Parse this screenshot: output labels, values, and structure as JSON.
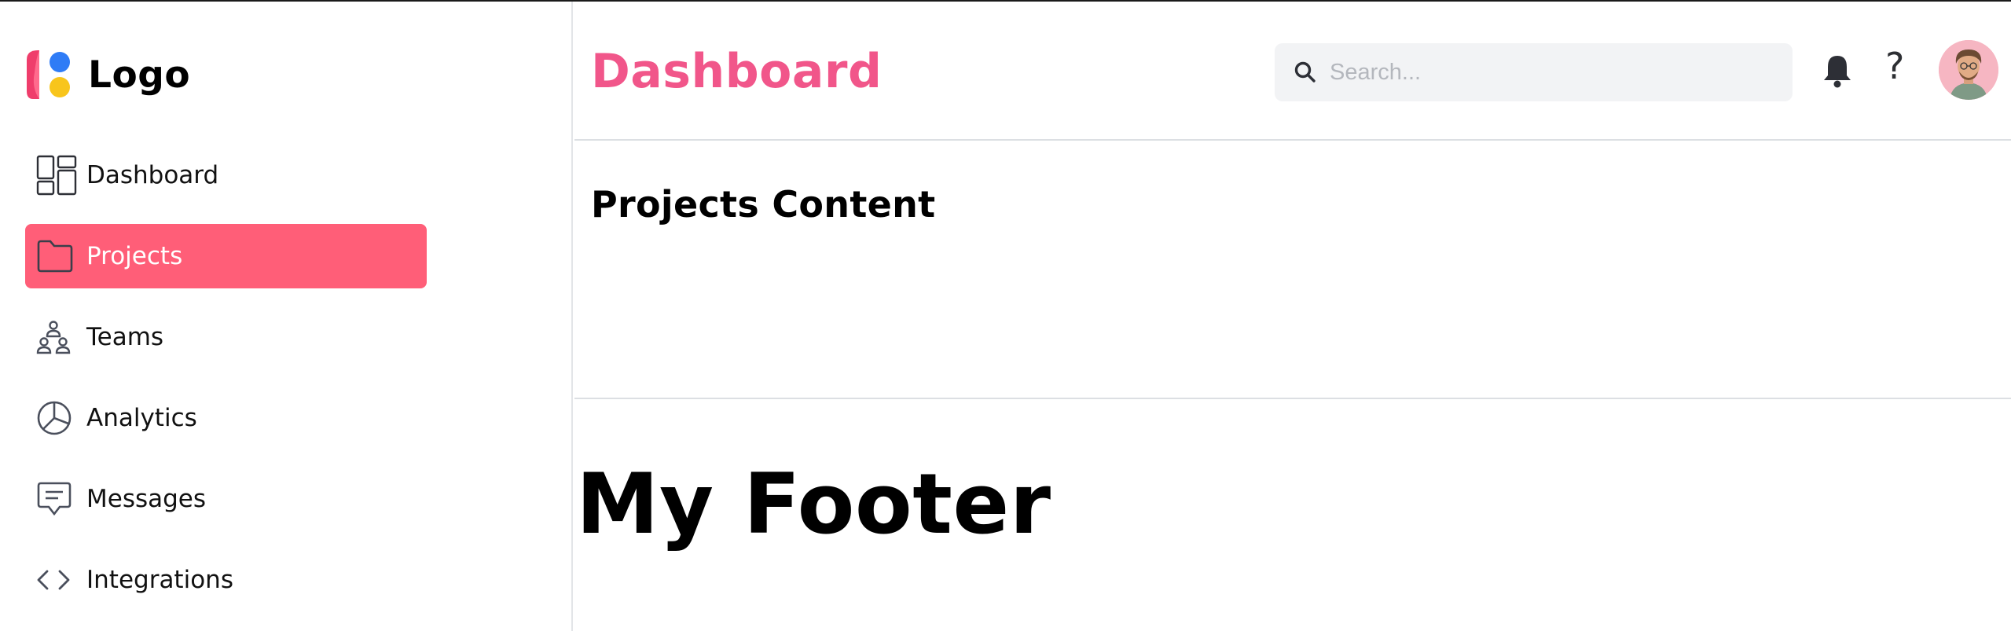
{
  "brand": {
    "logo_text": "Logo"
  },
  "sidebar": {
    "items": [
      {
        "label": "Dashboard",
        "icon": "dashboard-grid-icon",
        "active": false
      },
      {
        "label": "Projects",
        "icon": "folder-icon",
        "active": true
      },
      {
        "label": "Teams",
        "icon": "teams-icon",
        "active": false
      },
      {
        "label": "Analytics",
        "icon": "pie-chart-icon",
        "active": false
      },
      {
        "label": "Messages",
        "icon": "message-icon",
        "active": false
      },
      {
        "label": "Integrations",
        "icon": "code-icon",
        "active": false
      }
    ]
  },
  "header": {
    "title": "Dashboard",
    "search_placeholder": "Search...",
    "search_value": "",
    "help_label": "?"
  },
  "main": {
    "content_title": "Projects Content"
  },
  "footer": {
    "title": "My Footer"
  },
  "colors": {
    "accent_pink": "#f1568a",
    "active_nav": "#ff5e78",
    "logo_blue": "#2f7cf6",
    "logo_yellow": "#f8c51c"
  }
}
